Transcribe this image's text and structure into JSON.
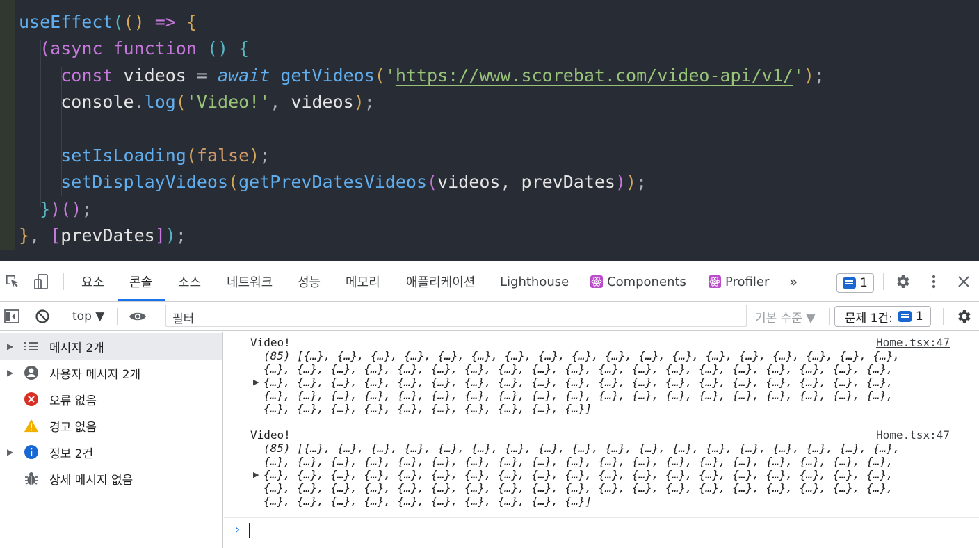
{
  "editor": {
    "lines": [
      [
        {
          "t": "useEffect",
          "c": "fn"
        },
        {
          "t": "(",
          "c": "p1"
        },
        {
          "t": "()",
          "c": "p2"
        },
        {
          "t": " => ",
          "c": "kw"
        },
        {
          "t": "{",
          "c": "p2"
        }
      ],
      [
        {
          "t": "  ",
          "c": "pn"
        },
        {
          "t": "(",
          "c": "p3"
        },
        {
          "t": "async function ",
          "c": "kw"
        },
        {
          "t": "()",
          "c": "p1"
        },
        {
          "t": " ",
          "c": "pn"
        },
        {
          "t": "{",
          "c": "p1"
        }
      ],
      [
        {
          "t": "    ",
          "c": "pn"
        },
        {
          "t": "const ",
          "c": "kw"
        },
        {
          "t": "videos ",
          "c": "var"
        },
        {
          "t": "= ",
          "c": "pn"
        },
        {
          "t": "await",
          "c": "it"
        },
        {
          "t": " getVideos",
          "c": "fn"
        },
        {
          "t": "(",
          "c": "p2"
        },
        {
          "t": "'",
          "c": "str"
        },
        {
          "t": "https://www.scorebat.com/video-api/v1/",
          "c": "url"
        },
        {
          "t": "'",
          "c": "str"
        },
        {
          "t": ")",
          "c": "p2"
        },
        {
          "t": ";",
          "c": "pn"
        }
      ],
      [
        {
          "t": "    ",
          "c": "pn"
        },
        {
          "t": "console",
          "c": "var"
        },
        {
          "t": ".",
          "c": "pn"
        },
        {
          "t": "log",
          "c": "fn"
        },
        {
          "t": "(",
          "c": "p2"
        },
        {
          "t": "'Video!'",
          "c": "str"
        },
        {
          "t": ", ",
          "c": "pn"
        },
        {
          "t": "videos",
          "c": "var"
        },
        {
          "t": ")",
          "c": "p2"
        },
        {
          "t": ";",
          "c": "pn"
        }
      ],
      [],
      [
        {
          "t": "    ",
          "c": "pn"
        },
        {
          "t": "setIsLoading",
          "c": "fn"
        },
        {
          "t": "(",
          "c": "p2"
        },
        {
          "t": "false",
          "c": "bool"
        },
        {
          "t": ")",
          "c": "p2"
        },
        {
          "t": ";",
          "c": "pn"
        }
      ],
      [
        {
          "t": "    ",
          "c": "pn"
        },
        {
          "t": "setDisplayVideos",
          "c": "fn"
        },
        {
          "t": "(",
          "c": "p2"
        },
        {
          "t": "getPrevDatesVideos",
          "c": "fn"
        },
        {
          "t": "(",
          "c": "p3"
        },
        {
          "t": "videos, prevDates",
          "c": "var"
        },
        {
          "t": ")",
          "c": "p3"
        },
        {
          "t": ")",
          "c": "p2"
        },
        {
          "t": ";",
          "c": "pn"
        }
      ],
      [
        {
          "t": "  ",
          "c": "pn"
        },
        {
          "t": "}",
          "c": "p1"
        },
        {
          "t": ")",
          "c": "p3"
        },
        {
          "t": "()",
          "c": "p3"
        },
        {
          "t": ";",
          "c": "pn"
        }
      ],
      [
        {
          "t": "}",
          "c": "p2"
        },
        {
          "t": ", ",
          "c": "pn"
        },
        {
          "t": "[",
          "c": "p3"
        },
        {
          "t": "prevDates",
          "c": "var"
        },
        {
          "t": "]",
          "c": "p3"
        },
        {
          "t": ")",
          "c": "p1"
        },
        {
          "t": ";",
          "c": "pn"
        }
      ]
    ]
  },
  "devtools": {
    "tabs": [
      "요소",
      "콘솔",
      "소스",
      "네트워크",
      "성능",
      "메모리",
      "애플리케이션",
      "Lighthouse",
      "Components",
      "Profiler"
    ],
    "active_tab": "콘솔",
    "more_tabs": "»",
    "issues_count": "1",
    "toolbar": {
      "context": "top ▼",
      "filter_placeholder": "필터",
      "levels": "기본 수준 ▼",
      "issues_label": "문제 1건:",
      "issues_count": "1"
    },
    "sidebar": [
      {
        "label": "메시지 2개",
        "icon": "list-icon",
        "expandable": true,
        "selected": true
      },
      {
        "label": "사용자 메시지 2개",
        "icon": "user-icon",
        "expandable": true,
        "selected": false
      },
      {
        "label": "오류 없음",
        "icon": "error-icon",
        "expandable": false,
        "selected": false
      },
      {
        "label": "경고 없음",
        "icon": "warning-icon",
        "expandable": false,
        "selected": false
      },
      {
        "label": "정보 2건",
        "icon": "info-icon",
        "expandable": true,
        "selected": false
      },
      {
        "label": "상세 메시지 없음",
        "icon": "bug-icon",
        "expandable": false,
        "selected": false
      }
    ],
    "messages": [
      {
        "title": "Video!",
        "source": "Home.tsx:47",
        "lines": [
          "(85) [{…}, {…}, {…}, {…}, {…}, {…}, {…}, {…}, {…}, {…}, {…}, {…}, {…}, {…}, {…}, {…}, {…}, {…},",
          "{…}, {…}, {…}, {…}, {…}, {…}, {…}, {…}, {…}, {…}, {…}, {…}, {…}, {…}, {…}, {…}, {…}, {…}, {…},",
          "{…}, {…}, {…}, {…}, {…}, {…}, {…}, {…}, {…}, {…}, {…}, {…}, {…}, {…}, {…}, {…}, {…}, {…}, {…},",
          "{…}, {…}, {…}, {…}, {…}, {…}, {…}, {…}, {…}, {…}, {…}, {…}, {…}, {…}, {…}, {…}, {…}, {…}, {…},",
          "{…}, {…}, {…}, {…}, {…}, {…}, {…}, {…}, {…}, {…}]"
        ]
      },
      {
        "title": "Video!",
        "source": "Home.tsx:47",
        "lines": [
          "(85) [{…}, {…}, {…}, {…}, {…}, {…}, {…}, {…}, {…}, {…}, {…}, {…}, {…}, {…}, {…}, {…}, {…}, {…},",
          "{…}, {…}, {…}, {…}, {…}, {…}, {…}, {…}, {…}, {…}, {…}, {…}, {…}, {…}, {…}, {…}, {…}, {…}, {…},",
          "{…}, {…}, {…}, {…}, {…}, {…}, {…}, {…}, {…}, {…}, {…}, {…}, {…}, {…}, {…}, {…}, {…}, {…}, {…},",
          "{…}, {…}, {…}, {…}, {…}, {…}, {…}, {…}, {…}, {…}, {…}, {…}, {…}, {…}, {…}, {…}, {…}, {…}, {…},",
          "{…}, {…}, {…}, {…}, {…}, {…}, {…}, {…}, {…}, {…}]"
        ]
      }
    ],
    "prompt": "›",
    "colors": {
      "accent": "#1a73e8",
      "badge": "#1a67d2",
      "error": "#d93025",
      "warning": "#f2b100",
      "info": "#1967d2"
    }
  }
}
